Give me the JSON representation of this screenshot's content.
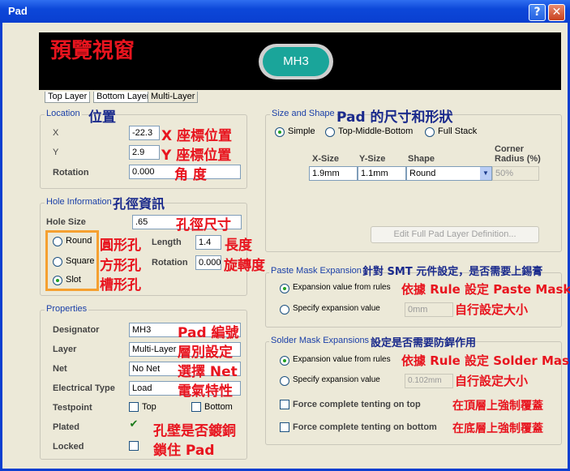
{
  "window": {
    "title": "Pad"
  },
  "preview": {
    "annotation": "預覽視窗",
    "pad_label": "MH3"
  },
  "tabs": [
    "Top Layer",
    "Bottom Layer",
    "Multi-Layer"
  ],
  "location": {
    "group_title": "Location",
    "annotation": "位置",
    "x_label": "X",
    "x_value": "-22.3",
    "x_note": "X 座標位置",
    "y_label": "Y",
    "y_value": "2.9",
    "y_note": "Y 座標位置",
    "rotation_label": "Rotation",
    "rotation_value": "0.000",
    "rotation_note": "角  度"
  },
  "hole": {
    "group_title": "Hole Information",
    "annotation": "孔徑資訊",
    "size_label": "Hole Size",
    "size_value": ".65",
    "size_note": "孔徑尺寸",
    "round": "Round",
    "round_note": "圓形孔",
    "square": "Square",
    "square_note": "方形孔",
    "slot": "Slot",
    "slot_note": "槽形孔",
    "length_label": "Length",
    "length_value": "1.4",
    "length_note": "長度",
    "rotation_label": "Rotation",
    "rotation_value": "0.000",
    "rotation_note": "旋轉度"
  },
  "properties": {
    "group_title": "Properties",
    "designator_label": "Designator",
    "designator_value": "MH3",
    "designator_note": "Pad 編號",
    "layer_label": "Layer",
    "layer_value": "Multi-Layer",
    "layer_note": "層別設定",
    "net_label": "Net",
    "net_value": "No Net",
    "net_note": "選擇 Net",
    "etype_label": "Electrical Type",
    "etype_value": "Load",
    "etype_note": "電氣特性",
    "testpoint_label": "Testpoint",
    "top": "Top",
    "bottom": "Bottom",
    "plated_label": "Plated",
    "locked_label": "Locked",
    "plated_note": "孔壁是否鍍銅",
    "locked_note": "鎖住 Pad"
  },
  "size_shape": {
    "group_title": "Size and Shape",
    "annotation": "Pad 的尺寸和形狀",
    "simple": "Simple",
    "tmb": "Top-Middle-Bottom",
    "full": "Full Stack",
    "col_x": "X-Size",
    "col_y": "Y-Size",
    "col_shape": "Shape",
    "col_corner1": "Corner",
    "col_corner2": "Radius (%)",
    "x_value": "1.9mm",
    "y_value": "1.1mm",
    "shape_value": "Round",
    "corner_value": "50%",
    "edit_button": "Edit Full Pad Layer Definition..."
  },
  "paste": {
    "group_title": "Paste Mask Expansion",
    "annotation": "針對 SMT 元件設定，是否需要上錫膏",
    "opt1": "Expansion value from rules",
    "opt1_note": "依據 Rule 設定 Paste Mask",
    "opt2": "Specify expansion value",
    "opt2_value": "0mm",
    "opt2_note": "自行設定大小"
  },
  "solder": {
    "group_title": "Solder Mask Expansions",
    "annotation": "設定是否需要防銲作用",
    "opt1": "Expansion value from rules",
    "opt1_note": "依據 Rule 設定 Solder Mask",
    "opt2": "Specify expansion value",
    "opt2_value": "0.102mm",
    "opt2_note": "自行設定大小",
    "tent_top": "Force complete tenting on top",
    "tent_top_note": "在頂層上強制覆蓋",
    "tent_bottom": "Force complete tenting on bottom",
    "tent_bottom_note": "在底層上強制覆蓋"
  },
  "colors": {
    "title_bar": "#0a3fd0",
    "pad": "#1aa59a",
    "annotation": "#e8141e",
    "highlight_box": "#f5a030"
  }
}
